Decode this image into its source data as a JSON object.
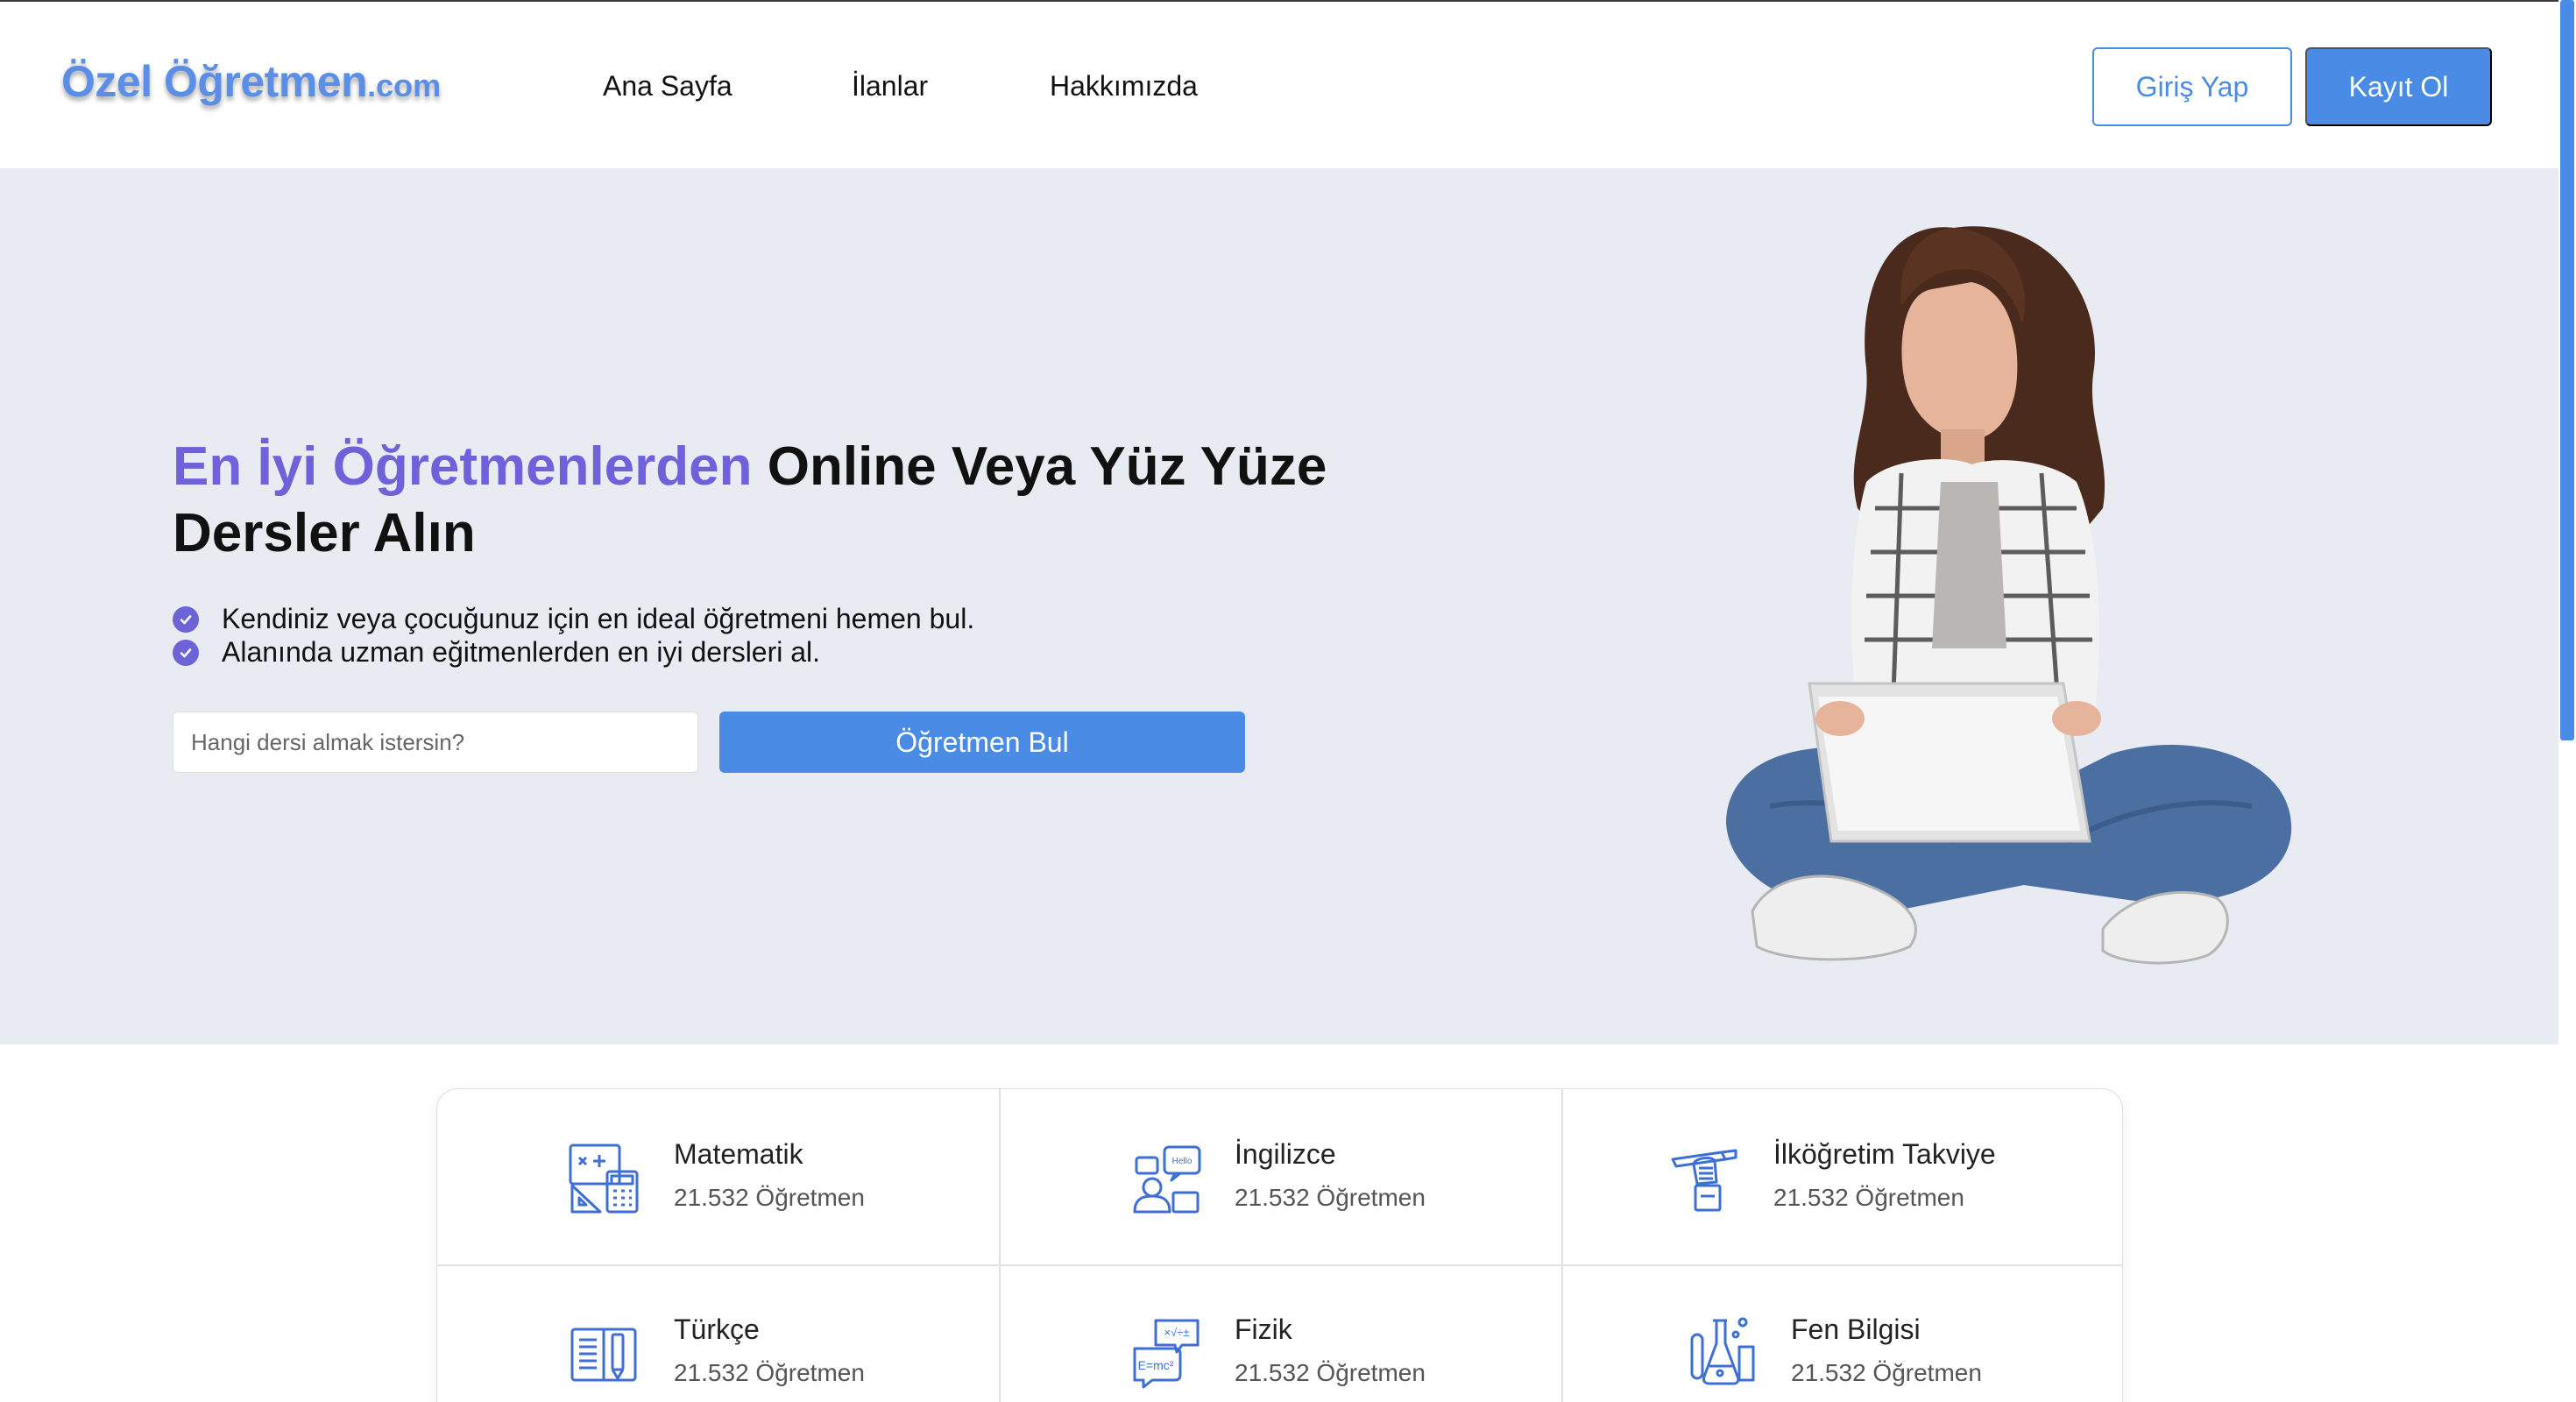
{
  "header": {
    "logo_main": "Özel Öğretmen",
    "logo_tld": ".com",
    "nav": [
      "Ana Sayfa",
      "İlanlar",
      "Hakkımızda"
    ],
    "login_label": "Giriş Yap",
    "register_label": "Kayıt Ol"
  },
  "hero": {
    "title_accent": "En İyi Öğretmenlerden",
    "title_rest": " Online Veya Yüz Yüze Dersler Alın",
    "bullets": [
      "Kendiniz veya çocuğunuz için en ideal öğretmeni hemen bul.",
      "Alanında uzman eğitmenlerden en iyi dersleri al."
    ],
    "search_placeholder": "Hangi dersi almak istersin?",
    "search_button": "Öğretmen Bul"
  },
  "categories": [
    {
      "name": "Matematik",
      "count": "21.532 Öğretmen",
      "icon": "math-icon"
    },
    {
      "name": "İngilizce",
      "count": "21.532 Öğretmen",
      "icon": "english-icon"
    },
    {
      "name": "İlköğretim Takviye",
      "count": "21.532 Öğretmen",
      "icon": "primary-school-icon"
    },
    {
      "name": "Türkçe",
      "count": "21.532 Öğretmen",
      "icon": "book-icon"
    },
    {
      "name": "Fizik",
      "count": "21.532 Öğretmen",
      "icon": "physics-icon"
    },
    {
      "name": "Fen Bilgisi",
      "count": "21.532 Öğretmen",
      "icon": "science-icon"
    }
  ],
  "colors": {
    "brand_blue": "#4a8be6",
    "accent_purple": "#6f61d9",
    "hero_bg": "#e9ebf2"
  }
}
